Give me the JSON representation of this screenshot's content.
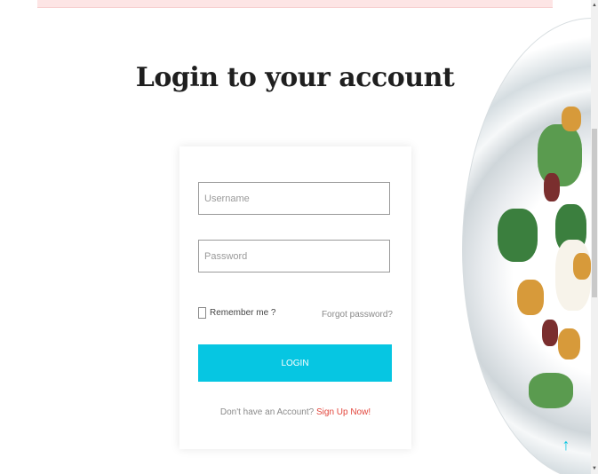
{
  "title": "Login to your account",
  "form": {
    "username_placeholder": "Username",
    "password_placeholder": "Password",
    "remember_label": "Remember me ?",
    "forgot_label": "Forgot password?",
    "login_label": "LOGIN",
    "signup_prompt": "Don't have an Account?",
    "signup_link": "Sign Up Now!"
  },
  "icons": {
    "back_to_top": "arrow-up-icon",
    "scroll_up": "chevron-up-icon",
    "scroll_down": "chevron-down-icon"
  },
  "colors": {
    "accent": "#06c6e2",
    "link": "#e2453b",
    "banner": "#fde5e5"
  }
}
